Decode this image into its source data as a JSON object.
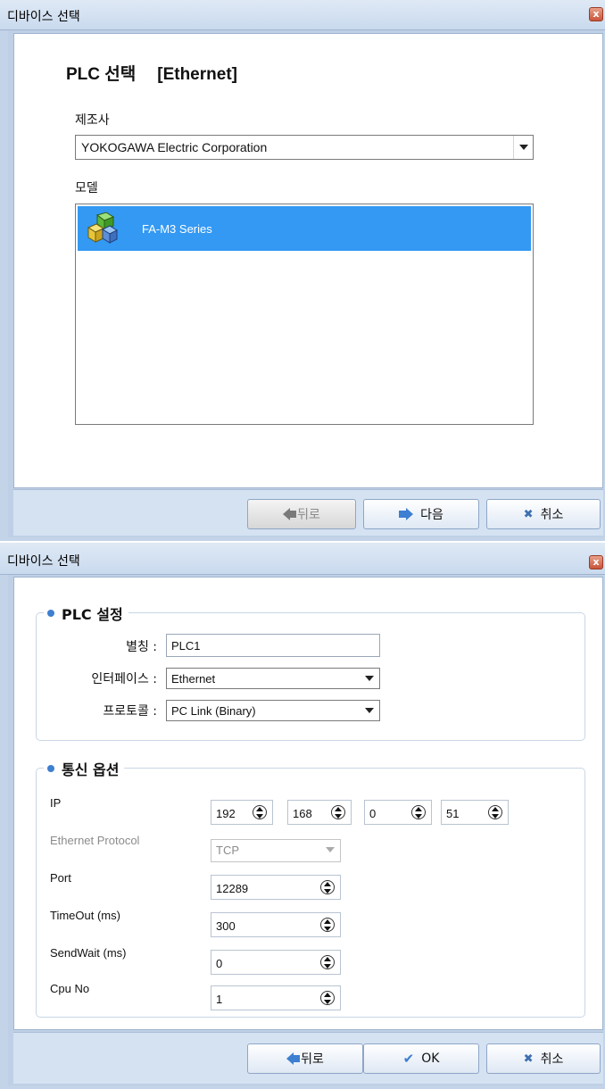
{
  "dialog1": {
    "title": "디바이스 선택",
    "close_glyph": "x",
    "heading": "PLC 선택",
    "heading_tag": "[Ethernet]",
    "manufacturer_label": "제조사",
    "manufacturer_value": "YOKOGAWA Electric Corporation",
    "model_label": "모델",
    "models": [
      {
        "label": "FA-M3 Series",
        "icon": "plc-cubes-icon",
        "selected": true
      }
    ],
    "buttons": {
      "back": "뒤로",
      "next": "다음",
      "cancel": "취소"
    }
  },
  "dialog2": {
    "title": "디바이스 선택",
    "close_glyph": "x",
    "plc_group": {
      "title": "PLC 설정",
      "alias_label": "별칭 :",
      "alias_value": "PLC1",
      "interface_label": "인터페이스 :",
      "interface_value": "Ethernet",
      "protocol_label": "프로토콜 :",
      "protocol_value": "PC Link (Binary)"
    },
    "comm_group": {
      "title": "통신 옵션",
      "ip_label": "IP",
      "ip": [
        "192",
        "168",
        "0",
        "51"
      ],
      "eth_protocol_label": "Ethernet Protocol",
      "eth_protocol_value": "TCP",
      "port_label": "Port",
      "port_value": "12289",
      "timeout_label": "TimeOut (ms)",
      "timeout_value": "300",
      "sendwait_label": "SendWait (ms)",
      "sendwait_value": "0",
      "cpu_label": "Cpu No",
      "cpu_value": "1"
    },
    "buttons": {
      "back": "뒤로",
      "ok": "OK",
      "cancel": "취소"
    }
  },
  "colors": {
    "selection": "#3399f3",
    "accent": "#3d7fd0",
    "frame": "#c3d3e8"
  }
}
